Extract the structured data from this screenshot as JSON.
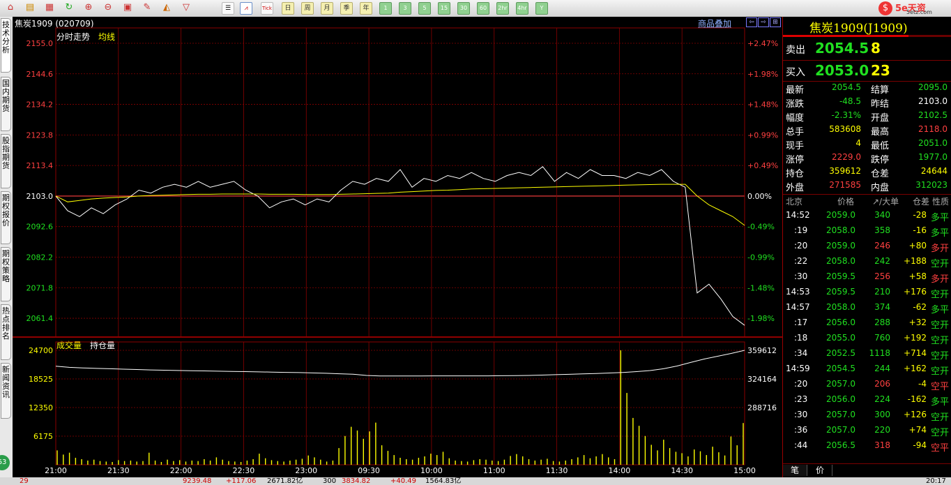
{
  "toolbar": {
    "tools": [
      "home-icon",
      "notebook-icon",
      "news-icon",
      "refresh-icon",
      "zoom-in-icon",
      "zoom-out-icon",
      "window-icon",
      "pen-icon",
      "draw-tool-icon",
      "filter-icon"
    ],
    "periods": [
      "日",
      "周",
      "月",
      "季",
      "年"
    ],
    "minutes": [
      "1",
      "3",
      "5",
      "15",
      "30",
      "60",
      "2hr",
      "4hr",
      "Y"
    ],
    "tick_label": "Tick"
  },
  "logo": {
    "brand": "5e天资",
    "site": "5etz.com"
  },
  "side_tabs": [
    "技术分析",
    "国内期货",
    "股指期货",
    "期权报价",
    "期权策略",
    "热点排名",
    "新闻资讯"
  ],
  "header": {
    "symbol": "焦炭1909 (020709)",
    "overlay_link": "商品叠加"
  },
  "price_panel": {
    "labels": [
      "分时走势",
      "均线"
    ],
    "y_ticks": [
      "2155.0",
      "2144.6",
      "2134.2",
      "2123.8",
      "2113.4",
      "2103.0",
      "2092.6",
      "2082.2",
      "2071.8",
      "2061.4"
    ],
    "pct_ticks": [
      "+2.47%",
      "+1.98%",
      "+1.48%",
      "+0.99%",
      "+0.49%",
      "0.00%",
      "-0.49%",
      "-0.99%",
      "-1.48%",
      "-1.98%"
    ]
  },
  "volume_panel": {
    "labels": [
      "成交量",
      "持仓量"
    ],
    "left_ticks": [
      "24700",
      "18525",
      "12350",
      "6175"
    ],
    "right_ticks": [
      "359612",
      "324164",
      "288716"
    ]
  },
  "time_axis": [
    "21:00",
    "21:30",
    "22:00",
    "22:30",
    "23:00",
    "09:30",
    "10:00",
    "11:00",
    "11:30",
    "14:00",
    "14:30",
    "15:00"
  ],
  "chart_data": {
    "type": "line",
    "reference_price": 2103.0,
    "y_range": [
      2055,
      2155
    ],
    "price_line": [
      2103,
      2098,
      2096,
      2099,
      2097,
      2100,
      2102,
      2105,
      2104,
      2106,
      2107,
      2106,
      2108,
      2106,
      2107,
      2108,
      2105,
      2103,
      2099,
      2101,
      2102,
      2100,
      2102,
      2101,
      2105,
      2108,
      2107,
      2109,
      2108,
      2112,
      2106,
      2109,
      2108,
      2110,
      2109,
      2111,
      2109,
      2108,
      2110,
      2111,
      2110,
      2113,
      2108,
      2111,
      2109,
      2112,
      2110,
      2110,
      2109,
      2111,
      2110,
      2112,
      2108,
      2106,
      2070,
      2073,
      2068,
      2062,
      2059
    ],
    "avg_line": [
      2103,
      2101,
      2101.5,
      2102,
      2102.3,
      2102.5,
      2102.7,
      2103,
      2103.2,
      2103.3,
      2103.4,
      2103.5,
      2103.6,
      2103.6,
      2103.7,
      2103.7,
      2103.7,
      2103.7,
      2103.6,
      2103.6,
      2103.6,
      2103.5,
      2103.5,
      2103.5,
      2103.6,
      2103.7,
      2103.8,
      2103.9,
      2104,
      2104.3,
      2104.5,
      2104.7,
      2104.9,
      2105,
      2105.2,
      2105.4,
      2105.5,
      2105.6,
      2105.7,
      2105.8,
      2105.9,
      2106,
      2106.1,
      2106.2,
      2106.3,
      2106.4,
      2106.5,
      2106.6,
      2106.7,
      2106.8,
      2106.9,
      2107,
      2107,
      2107,
      2103,
      2100,
      2098,
      2096,
      2093
    ],
    "open_interest": [
      340000,
      338500,
      337800,
      337200,
      336800,
      336300,
      335800,
      335300,
      335000,
      334600,
      334300,
      334100,
      333800,
      333500,
      333200,
      332900,
      332600,
      332300,
      332000,
      331600,
      331200,
      330600,
      330000,
      328500,
      327800,
      327800,
      327800,
      327900,
      328000,
      328000,
      328000,
      328000,
      328000,
      328100,
      328200,
      328500,
      328900,
      329400,
      329900,
      330400,
      330900,
      331500,
      332200,
      333200,
      334500,
      336800,
      340200,
      344600,
      348800,
      352300,
      355700,
      359612
    ],
    "volume": [
      3100,
      2200,
      2600,
      1500,
      1200,
      900,
      1100,
      800,
      700,
      600,
      1000,
      800,
      900,
      700,
      800,
      2600,
      900,
      600,
      1100,
      800,
      1000,
      700,
      900,
      800,
      1200,
      900,
      1600,
      1100,
      800,
      700,
      600,
      900,
      1200,
      2400,
      1400,
      1000,
      800,
      700,
      900,
      1100,
      1300,
      2000,
      1600,
      1100,
      700,
      900,
      3600,
      6200,
      8200,
      7400,
      5600,
      7200,
      9100,
      4200,
      3000,
      2100,
      1500,
      1200,
      1100,
      1500,
      1800,
      2400,
      2100,
      2800,
      1400,
      900,
      800,
      700,
      1000,
      1200,
      1100,
      900,
      800,
      1100,
      1900,
      2300,
      1800,
      1200,
      900,
      1100,
      1300,
      800,
      700,
      900,
      1200,
      1600,
      2100,
      1400,
      1800,
      2300,
      1600,
      1200,
      24700,
      15500,
      10100,
      8400,
      6200,
      4300,
      3100,
      5400,
      3600,
      2800,
      2500,
      1800,
      3300,
      2900,
      2100,
      3900,
      2700,
      2000,
      6100,
      4200,
      9000
    ]
  },
  "quote": {
    "title": "焦炭1909(J1909)",
    "sell_label": "卖出",
    "sell_price": "2054.5",
    "sell_qty": "8",
    "buy_label": "买入",
    "buy_price": "2053.0",
    "buy_qty": "23",
    "rows": [
      {
        "l1": "最新",
        "v1": "2054.5",
        "c1": "#20e020",
        "l2": "结算",
        "v2": "2095.0",
        "c2": "#20e020"
      },
      {
        "l1": "涨跌",
        "v1": "-48.5",
        "c1": "#20e020",
        "l2": "昨结",
        "v2": "2103.0",
        "c2": "#ffffff"
      },
      {
        "l1": "幅度",
        "v1": "-2.31%",
        "c1": "#20e020",
        "l2": "开盘",
        "v2": "2102.5",
        "c2": "#20e020"
      },
      {
        "l1": "总手",
        "v1": "583608",
        "c1": "#ffff00",
        "l2": "最高",
        "v2": "2118.0",
        "c2": "#ff4040"
      },
      {
        "l1": "现手",
        "v1": "4",
        "c1": "#ffff00",
        "l2": "最低",
        "v2": "2051.0",
        "c2": "#20e020"
      },
      {
        "l1": "涨停",
        "v1": "2229.0",
        "c1": "#ff4040",
        "l2": "跌停",
        "v2": "1977.0",
        "c2": "#20e020"
      },
      {
        "l1": "持仓",
        "v1": "359612",
        "c1": "#ffff00",
        "l2": "仓差",
        "v2": "24644",
        "c2": "#ffff00"
      },
      {
        "l1": "外盘",
        "v1": "271585",
        "c1": "#ff4040",
        "l2": "内盘",
        "v2": "312023",
        "c2": "#20e020"
      }
    ],
    "tick_header": [
      "北京",
      "价格",
      "↗/大单",
      "仓差",
      "性质"
    ],
    "ticks": [
      {
        "t": "14:52",
        "p": "2059.0",
        "v": "340",
        "vc": "#20e020",
        "d": "-28",
        "n": "多平",
        "nc": "#20e020"
      },
      {
        "t": ":19",
        "p": "2058.0",
        "v": "358",
        "vc": "#20e020",
        "d": "-16",
        "n": "多平",
        "nc": "#20e020"
      },
      {
        "t": ":20",
        "p": "2059.0",
        "v": "246",
        "vc": "#ff4040",
        "d": "+80",
        "n": "多开",
        "nc": "#ff4040"
      },
      {
        "t": ":22",
        "p": "2058.0",
        "v": "242",
        "vc": "#20e020",
        "d": "+188",
        "n": "空开",
        "nc": "#20e020"
      },
      {
        "t": ":30",
        "p": "2059.5",
        "v": "256",
        "vc": "#ff4040",
        "d": "+58",
        "n": "多开",
        "nc": "#ff4040"
      },
      {
        "t": "14:53",
        "p": "2059.5",
        "v": "210",
        "vc": "#20e020",
        "d": "+176",
        "n": "空开",
        "nc": "#20e020"
      },
      {
        "t": "14:57",
        "p": "2058.0",
        "v": "374",
        "vc": "#20e020",
        "d": "-62",
        "n": "多平",
        "nc": "#20e020"
      },
      {
        "t": ":17",
        "p": "2056.0",
        "v": "288",
        "vc": "#20e020",
        "d": "+32",
        "n": "空开",
        "nc": "#20e020"
      },
      {
        "t": ":18",
        "p": "2055.0",
        "v": "760",
        "vc": "#20e020",
        "d": "+192",
        "n": "空开",
        "nc": "#20e020"
      },
      {
        "t": ":34",
        "p": "2052.5",
        "v": "1118",
        "vc": "#20e020",
        "d": "+714",
        "n": "空开",
        "nc": "#20e020"
      },
      {
        "t": "14:59",
        "p": "2054.5",
        "v": "244",
        "vc": "#20e020",
        "d": "+162",
        "n": "空开",
        "nc": "#20e020"
      },
      {
        "t": ":20",
        "p": "2057.0",
        "v": "206",
        "vc": "#ff4040",
        "d": "-4",
        "n": "空平",
        "nc": "#ff4040"
      },
      {
        "t": ":23",
        "p": "2056.0",
        "v": "224",
        "vc": "#20e020",
        "d": "-162",
        "n": "多平",
        "nc": "#20e020"
      },
      {
        "t": ":30",
        "p": "2057.0",
        "v": "300",
        "vc": "#20e020",
        "d": "+126",
        "n": "空开",
        "nc": "#20e020"
      },
      {
        "t": ":36",
        "p": "2057.0",
        "v": "220",
        "vc": "#20e020",
        "d": "+74",
        "n": "空开",
        "nc": "#20e020"
      },
      {
        "t": ":44",
        "p": "2056.5",
        "v": "318",
        "vc": "#ff4040",
        "d": "-94",
        "n": "空平",
        "nc": "#ff4040"
      }
    ],
    "bottom_tabs": [
      "笔",
      "价"
    ]
  },
  "status": {
    "index1_value": "9239.48",
    "index1_change": "+117.06",
    "index1_amount": "2671.82亿",
    "index2_name": "300",
    "index2_value": "3834.82",
    "index2_change": "+40.49",
    "index2_amount": "1564.83亿",
    "time": "20:17"
  },
  "colors": {
    "grid": "#8b0000",
    "up": "#ff4040",
    "down": "#20e020",
    "price_line": "#ffffff",
    "avg_line": "#ffff00",
    "axis_text_yellow": "#ffff00"
  }
}
